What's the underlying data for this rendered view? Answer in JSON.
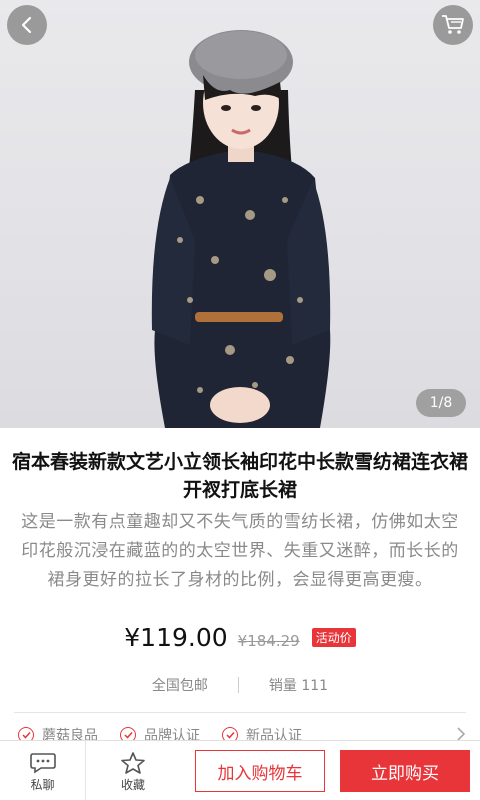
{
  "header": {
    "back_icon": "chevron-left-icon",
    "cart_icon": "shopping-cart-icon",
    "image_counter": "1/8"
  },
  "product": {
    "title": "宿本春装新款文艺小立领长袖印花中长款雪纺裙连衣裙开衩打底长裙",
    "description": "这是一款有点童趣却又不失气质的雪纺长裙，仿佛如太空印花般沉浸在藏蓝的的太空世界、失重又迷醉，而长长的裙身更好的拉长了身材的比例，会显得更高更瘦。",
    "price": "¥119.00",
    "original_price": "¥184.29",
    "promo_badge": "活动价",
    "shipping": "全国包邮",
    "sales": "销量 111",
    "tags": [
      "蘑菇良品",
      "品牌认证",
      "新品认证"
    ]
  },
  "bottom_bar": {
    "chat_label": "私聊",
    "favorite_label": "收藏",
    "add_to_cart": "加入购物车",
    "buy_now": "立即购买"
  },
  "colors": {
    "accent": "#e8353a",
    "dress": "#1f2535",
    "background": "#e6e6ea"
  }
}
